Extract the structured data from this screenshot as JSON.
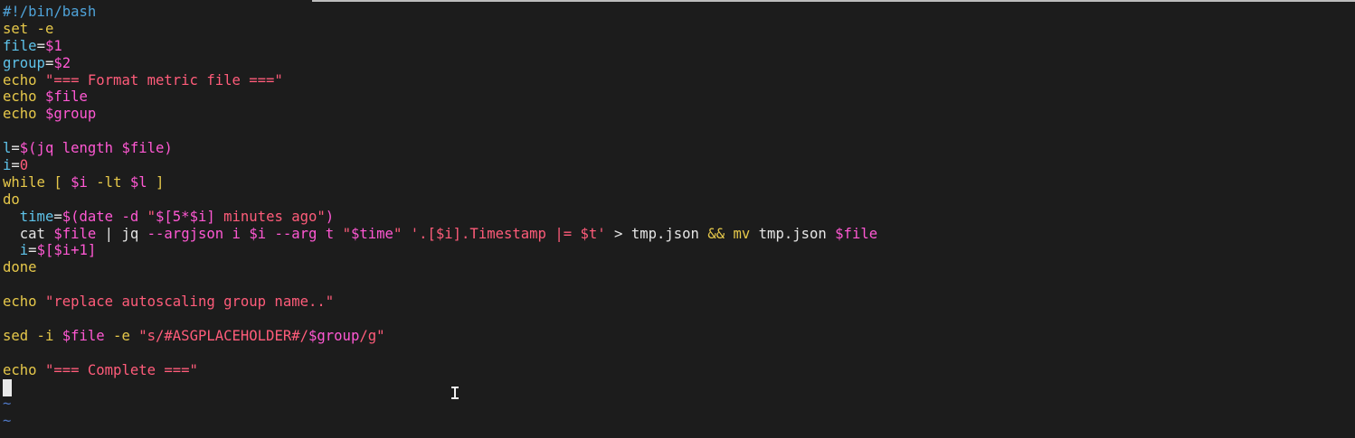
{
  "editor": {
    "lines": [
      [
        {
          "t": "#!/bin/bash",
          "c": "shebang"
        }
      ],
      [
        {
          "t": "set -e",
          "c": "keyword"
        }
      ],
      [
        {
          "t": "file",
          "c": "var"
        },
        {
          "t": "=",
          "c": "plain"
        },
        {
          "t": "$1",
          "c": "special"
        }
      ],
      [
        {
          "t": "group",
          "c": "var"
        },
        {
          "t": "=",
          "c": "plain"
        },
        {
          "t": "$2",
          "c": "special"
        }
      ],
      [
        {
          "t": "echo ",
          "c": "keyword"
        },
        {
          "t": "\"=== Format metric file ===\"",
          "c": "string"
        }
      ],
      [
        {
          "t": "echo ",
          "c": "keyword"
        },
        {
          "t": "$file",
          "c": "special"
        }
      ],
      [
        {
          "t": "echo ",
          "c": "keyword"
        },
        {
          "t": "$group",
          "c": "special"
        }
      ],
      [],
      [
        {
          "t": "l",
          "c": "var"
        },
        {
          "t": "=",
          "c": "plain"
        },
        {
          "t": "$(jq length $file)",
          "c": "special"
        }
      ],
      [
        {
          "t": "i",
          "c": "var"
        },
        {
          "t": "=",
          "c": "plain"
        },
        {
          "t": "0",
          "c": "string"
        }
      ],
      [
        {
          "t": "while ",
          "c": "keyword"
        },
        {
          "t": "[ ",
          "c": "keyword"
        },
        {
          "t": "$i",
          "c": "special"
        },
        {
          "t": " -lt ",
          "c": "keyword"
        },
        {
          "t": "$l",
          "c": "special"
        },
        {
          "t": " ]",
          "c": "keyword"
        }
      ],
      [
        {
          "t": "do",
          "c": "keyword"
        }
      ],
      [
        {
          "t": "  ",
          "c": "plain"
        },
        {
          "t": "time",
          "c": "var"
        },
        {
          "t": "=",
          "c": "plain"
        },
        {
          "t": "$(date -d ",
          "c": "special"
        },
        {
          "t": "\"",
          "c": "string"
        },
        {
          "t": "$[5*$i]",
          "c": "special"
        },
        {
          "t": " minutes ago\"",
          "c": "string"
        },
        {
          "t": ")",
          "c": "special"
        }
      ],
      [
        {
          "t": "  cat ",
          "c": "plain"
        },
        {
          "t": "$file",
          "c": "special"
        },
        {
          "t": " | jq ",
          "c": "plain"
        },
        {
          "t": "--argjson i ",
          "c": "special"
        },
        {
          "t": "$i",
          "c": "special"
        },
        {
          "t": " --arg t ",
          "c": "special"
        },
        {
          "t": "\"",
          "c": "string"
        },
        {
          "t": "$time",
          "c": "special"
        },
        {
          "t": "\"",
          "c": "string"
        },
        {
          "t": " ",
          "c": "plain"
        },
        {
          "t": "'.[$i].Timestamp |= $t'",
          "c": "string"
        },
        {
          "t": " > tmp.json ",
          "c": "plain"
        },
        {
          "t": "&&",
          "c": "keyword"
        },
        {
          "t": " ",
          "c": "plain"
        },
        {
          "t": "mv",
          "c": "keyword"
        },
        {
          "t": " tmp.json ",
          "c": "plain"
        },
        {
          "t": "$file",
          "c": "special"
        }
      ],
      [
        {
          "t": "  ",
          "c": "plain"
        },
        {
          "t": "i",
          "c": "var"
        },
        {
          "t": "=",
          "c": "plain"
        },
        {
          "t": "$[$i+1]",
          "c": "special"
        }
      ],
      [
        {
          "t": "done",
          "c": "keyword"
        }
      ],
      [],
      [
        {
          "t": "echo ",
          "c": "keyword"
        },
        {
          "t": "\"replace autoscaling group name..\"",
          "c": "string"
        }
      ],
      [],
      [
        {
          "t": "sed -i ",
          "c": "keyword"
        },
        {
          "t": "$file",
          "c": "special"
        },
        {
          "t": " -e ",
          "c": "keyword"
        },
        {
          "t": "\"s/#ASGPLACEHOLDER#/",
          "c": "string"
        },
        {
          "t": "$group",
          "c": "special"
        },
        {
          "t": "/g\"",
          "c": "string"
        }
      ],
      [],
      [
        {
          "t": "echo ",
          "c": "keyword"
        },
        {
          "t": "\"=== Complete ===\"",
          "c": "string"
        }
      ],
      [
        "CURSOR"
      ],
      [
        {
          "t": "~",
          "c": "tilde"
        }
      ],
      [
        {
          "t": "~",
          "c": "tilde"
        }
      ]
    ]
  }
}
